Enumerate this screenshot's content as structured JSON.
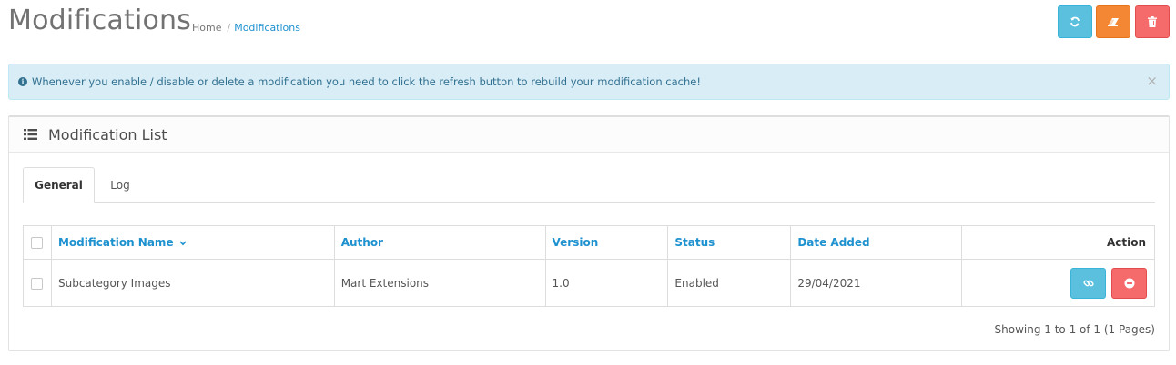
{
  "header": {
    "title": "Modifications",
    "breadcrumb": [
      {
        "label": "Home"
      },
      {
        "label": "Modifications"
      }
    ],
    "buttons": [
      {
        "icon": "refresh-icon",
        "color": "#5bc0de"
      },
      {
        "icon": "eraser-icon",
        "color": "#f38733"
      },
      {
        "icon": "trash-icon",
        "color": "#f56b6b"
      }
    ]
  },
  "alert": {
    "text": "Whenever you enable / disable or delete a modification you need to click the refresh button to rebuild your modification cache!",
    "close": "×",
    "icon": "info-circle-icon"
  },
  "panel": {
    "title": "Modification List",
    "icon": "list-icon",
    "tabs": [
      {
        "label": "General",
        "active": true
      },
      {
        "label": "Log",
        "active": false
      }
    ],
    "table": {
      "columns": [
        "Modification Name",
        "Author",
        "Version",
        "Status",
        "Date Added",
        "Action"
      ],
      "rows": [
        {
          "name": "Subcategory Images",
          "author": "Mart Extensions",
          "version": "1.0",
          "status": "Enabled",
          "date_added": "29/04/2021",
          "actions": [
            {
              "icon": "link-icon",
              "color": "#5bc0de"
            },
            {
              "icon": "minus-circle-icon",
              "color": "#f56b6b"
            }
          ]
        }
      ]
    },
    "pagination_text": "Showing 1 to 1 of 1 (1 Pages)"
  }
}
